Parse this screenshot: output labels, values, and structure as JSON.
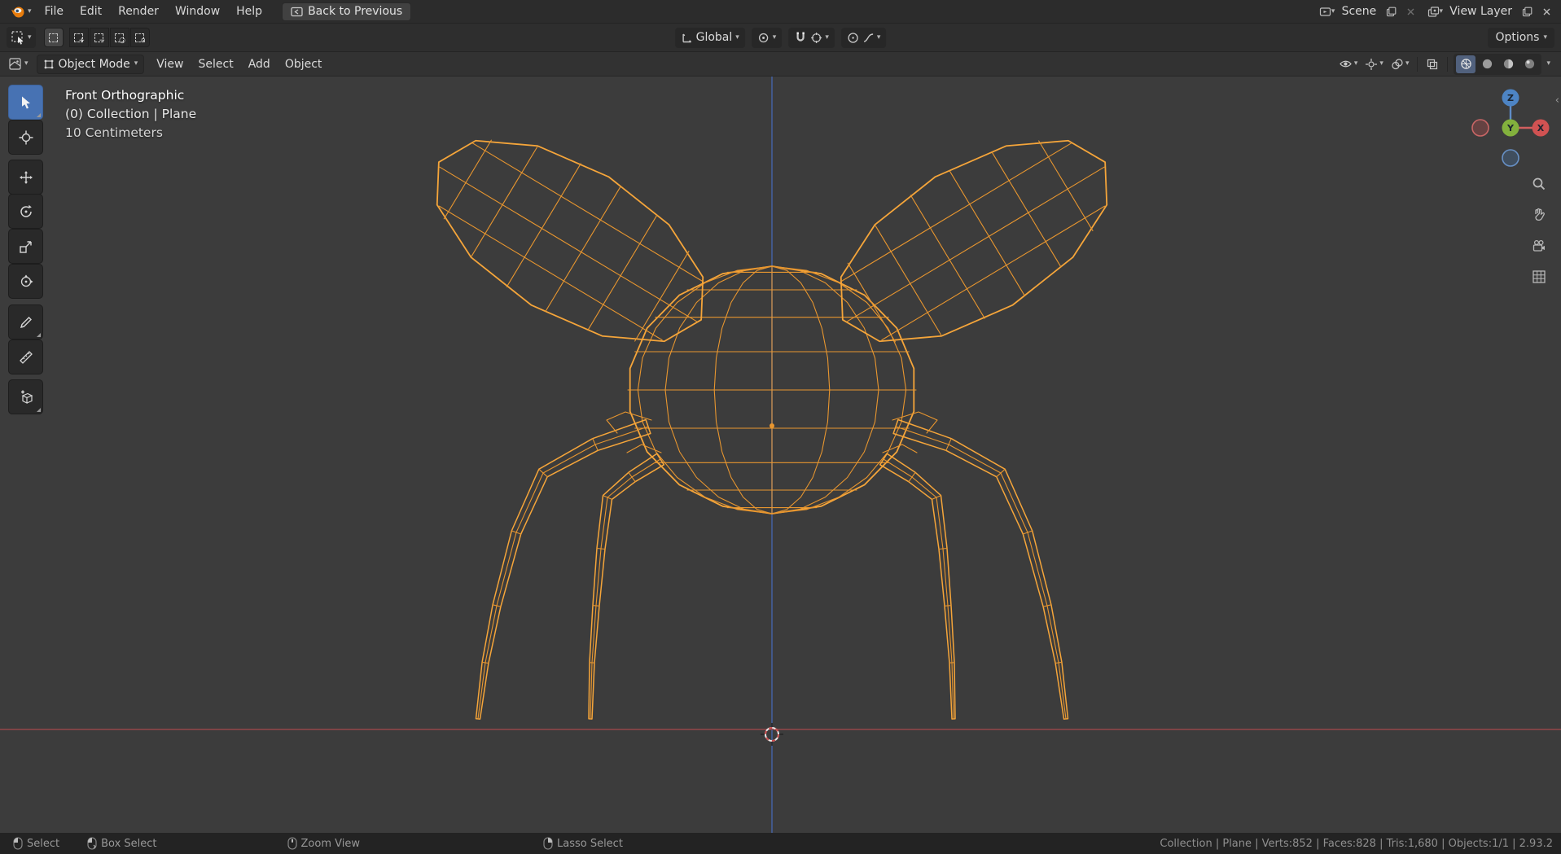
{
  "topbar": {
    "menus": [
      {
        "label": "File"
      },
      {
        "label": "Edit"
      },
      {
        "label": "Render"
      },
      {
        "label": "Window"
      },
      {
        "label": "Help"
      }
    ],
    "back_button_label": "Back to Previous",
    "scene_selector": {
      "label": "Scene"
    },
    "view_layer_selector": {
      "label": "View Layer"
    }
  },
  "tool_settings": {
    "orientation_label": "Global",
    "options_label": "Options"
  },
  "viewport_header": {
    "mode_label": "Object Mode",
    "menus": [
      {
        "label": "View"
      },
      {
        "label": "Select"
      },
      {
        "label": "Add"
      },
      {
        "label": "Object"
      }
    ]
  },
  "viewport_overlay": {
    "view_name": "Front Orthographic",
    "context_path": "(0) Collection | Plane",
    "grid_scale": "10 Centimeters"
  },
  "nav_gizmo": {
    "x_label": "X",
    "y_label": "Y",
    "z_label": "Z"
  },
  "status_bar": {
    "hints": [
      {
        "label": "Select"
      },
      {
        "label": "Box Select"
      },
      {
        "label": "Zoom View"
      },
      {
        "label": "Lasso Select"
      }
    ],
    "stats": "Collection | Plane | Verts:852 | Faces:828 | Tris:1,680 | Objects:1/1 | 2.93.2"
  },
  "colors": {
    "accent_blue": "#4772b3",
    "wire_orange": "#e8962f",
    "wire_bright": "#f5a53a",
    "axis_x_red": "#94464a",
    "axis_z_blue": "#44609b"
  }
}
